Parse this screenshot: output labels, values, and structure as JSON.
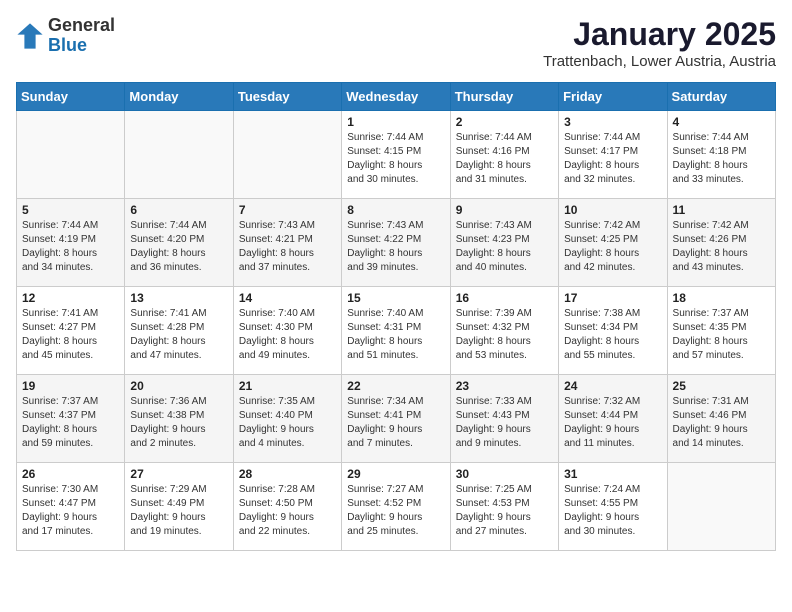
{
  "logo": {
    "general": "General",
    "blue": "Blue"
  },
  "title": "January 2025",
  "subtitle": "Trattenbach, Lower Austria, Austria",
  "days_of_week": [
    "Sunday",
    "Monday",
    "Tuesday",
    "Wednesday",
    "Thursday",
    "Friday",
    "Saturday"
  ],
  "weeks": [
    [
      {
        "day": "",
        "info": ""
      },
      {
        "day": "",
        "info": ""
      },
      {
        "day": "",
        "info": ""
      },
      {
        "day": "1",
        "info": "Sunrise: 7:44 AM\nSunset: 4:15 PM\nDaylight: 8 hours\nand 30 minutes."
      },
      {
        "day": "2",
        "info": "Sunrise: 7:44 AM\nSunset: 4:16 PM\nDaylight: 8 hours\nand 31 minutes."
      },
      {
        "day": "3",
        "info": "Sunrise: 7:44 AM\nSunset: 4:17 PM\nDaylight: 8 hours\nand 32 minutes."
      },
      {
        "day": "4",
        "info": "Sunrise: 7:44 AM\nSunset: 4:18 PM\nDaylight: 8 hours\nand 33 minutes."
      }
    ],
    [
      {
        "day": "5",
        "info": "Sunrise: 7:44 AM\nSunset: 4:19 PM\nDaylight: 8 hours\nand 34 minutes."
      },
      {
        "day": "6",
        "info": "Sunrise: 7:44 AM\nSunset: 4:20 PM\nDaylight: 8 hours\nand 36 minutes."
      },
      {
        "day": "7",
        "info": "Sunrise: 7:43 AM\nSunset: 4:21 PM\nDaylight: 8 hours\nand 37 minutes."
      },
      {
        "day": "8",
        "info": "Sunrise: 7:43 AM\nSunset: 4:22 PM\nDaylight: 8 hours\nand 39 minutes."
      },
      {
        "day": "9",
        "info": "Sunrise: 7:43 AM\nSunset: 4:23 PM\nDaylight: 8 hours\nand 40 minutes."
      },
      {
        "day": "10",
        "info": "Sunrise: 7:42 AM\nSunset: 4:25 PM\nDaylight: 8 hours\nand 42 minutes."
      },
      {
        "day": "11",
        "info": "Sunrise: 7:42 AM\nSunset: 4:26 PM\nDaylight: 8 hours\nand 43 minutes."
      }
    ],
    [
      {
        "day": "12",
        "info": "Sunrise: 7:41 AM\nSunset: 4:27 PM\nDaylight: 8 hours\nand 45 minutes."
      },
      {
        "day": "13",
        "info": "Sunrise: 7:41 AM\nSunset: 4:28 PM\nDaylight: 8 hours\nand 47 minutes."
      },
      {
        "day": "14",
        "info": "Sunrise: 7:40 AM\nSunset: 4:30 PM\nDaylight: 8 hours\nand 49 minutes."
      },
      {
        "day": "15",
        "info": "Sunrise: 7:40 AM\nSunset: 4:31 PM\nDaylight: 8 hours\nand 51 minutes."
      },
      {
        "day": "16",
        "info": "Sunrise: 7:39 AM\nSunset: 4:32 PM\nDaylight: 8 hours\nand 53 minutes."
      },
      {
        "day": "17",
        "info": "Sunrise: 7:38 AM\nSunset: 4:34 PM\nDaylight: 8 hours\nand 55 minutes."
      },
      {
        "day": "18",
        "info": "Sunrise: 7:37 AM\nSunset: 4:35 PM\nDaylight: 8 hours\nand 57 minutes."
      }
    ],
    [
      {
        "day": "19",
        "info": "Sunrise: 7:37 AM\nSunset: 4:37 PM\nDaylight: 8 hours\nand 59 minutes."
      },
      {
        "day": "20",
        "info": "Sunrise: 7:36 AM\nSunset: 4:38 PM\nDaylight: 9 hours\nand 2 minutes."
      },
      {
        "day": "21",
        "info": "Sunrise: 7:35 AM\nSunset: 4:40 PM\nDaylight: 9 hours\nand 4 minutes."
      },
      {
        "day": "22",
        "info": "Sunrise: 7:34 AM\nSunset: 4:41 PM\nDaylight: 9 hours\nand 7 minutes."
      },
      {
        "day": "23",
        "info": "Sunrise: 7:33 AM\nSunset: 4:43 PM\nDaylight: 9 hours\nand 9 minutes."
      },
      {
        "day": "24",
        "info": "Sunrise: 7:32 AM\nSunset: 4:44 PM\nDaylight: 9 hours\nand 11 minutes."
      },
      {
        "day": "25",
        "info": "Sunrise: 7:31 AM\nSunset: 4:46 PM\nDaylight: 9 hours\nand 14 minutes."
      }
    ],
    [
      {
        "day": "26",
        "info": "Sunrise: 7:30 AM\nSunset: 4:47 PM\nDaylight: 9 hours\nand 17 minutes."
      },
      {
        "day": "27",
        "info": "Sunrise: 7:29 AM\nSunset: 4:49 PM\nDaylight: 9 hours\nand 19 minutes."
      },
      {
        "day": "28",
        "info": "Sunrise: 7:28 AM\nSunset: 4:50 PM\nDaylight: 9 hours\nand 22 minutes."
      },
      {
        "day": "29",
        "info": "Sunrise: 7:27 AM\nSunset: 4:52 PM\nDaylight: 9 hours\nand 25 minutes."
      },
      {
        "day": "30",
        "info": "Sunrise: 7:25 AM\nSunset: 4:53 PM\nDaylight: 9 hours\nand 27 minutes."
      },
      {
        "day": "31",
        "info": "Sunrise: 7:24 AM\nSunset: 4:55 PM\nDaylight: 9 hours\nand 30 minutes."
      },
      {
        "day": "",
        "info": ""
      }
    ]
  ]
}
